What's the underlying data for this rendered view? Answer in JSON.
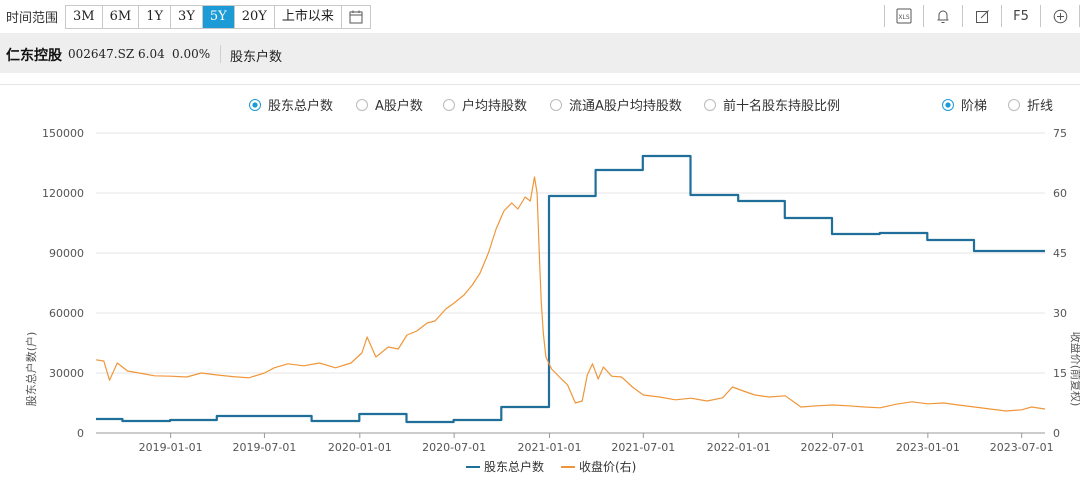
{
  "toolbar": {
    "range_label": "时间范围",
    "ranges": [
      "3M",
      "6M",
      "1Y",
      "3Y",
      "5Y",
      "20Y",
      "上市以来"
    ],
    "active_range": "5Y",
    "tools": [
      "XLS",
      "F5"
    ]
  },
  "stock": {
    "name": "仁东控股",
    "code": "002647.SZ",
    "price": "6.04",
    "change": "0.00%",
    "panel_title": "股东户数"
  },
  "options": {
    "metrics": [
      "股东总户数",
      "A股户数",
      "户均持股数",
      "流通A股户均持股数",
      "前十名股东持股比例"
    ],
    "selected_metric": "股东总户数",
    "styles": [
      "阶梯",
      "折线"
    ],
    "selected_style": "阶梯"
  },
  "colors": {
    "accent": "#1d9bd6",
    "holders": "#1f6f9a",
    "price": "#f0963a",
    "grid": "#e5e5e5"
  },
  "chart_data": {
    "type": "line",
    "ylabel": "股东总户数(户)",
    "y2label": "收盘价(前复权)",
    "ylim": [
      0,
      150000
    ],
    "y2lim": [
      0,
      75
    ],
    "yticks": [
      0,
      30000,
      60000,
      90000,
      120000,
      150000
    ],
    "y2ticks": [
      0,
      15,
      30,
      45,
      60,
      75
    ],
    "xlim": [
      "2018-08-10",
      "2023-08-15"
    ],
    "xticks": [
      "2019-01-01",
      "2019-07-01",
      "2020-01-01",
      "2020-07-01",
      "2021-01-01",
      "2021-07-01",
      "2022-01-01",
      "2022-07-01",
      "2023-01-01",
      "2023-07-01"
    ],
    "legend": [
      "股东总户数",
      "收盘价(右)"
    ],
    "grid": true,
    "series": [
      {
        "name": "股东总户数",
        "axis": "left",
        "style": "step",
        "points": [
          [
            "2018-08-10",
            7000
          ],
          [
            "2018-09-30",
            6000
          ],
          [
            "2018-12-31",
            6500
          ],
          [
            "2019-03-31",
            8500
          ],
          [
            "2019-06-30",
            8500
          ],
          [
            "2019-09-30",
            6000
          ],
          [
            "2019-12-31",
            9500
          ],
          [
            "2020-03-31",
            5500
          ],
          [
            "2020-06-30",
            6500
          ],
          [
            "2020-09-30",
            13000
          ],
          [
            "2020-12-31",
            118500
          ],
          [
            "2021-03-31",
            131500
          ],
          [
            "2021-06-30",
            138500
          ],
          [
            "2021-09-30",
            119000
          ],
          [
            "2021-12-31",
            116000
          ],
          [
            "2022-03-31",
            107500
          ],
          [
            "2022-06-30",
            99500
          ],
          [
            "2022-09-30",
            100000
          ],
          [
            "2022-12-31",
            96500
          ],
          [
            "2023-03-31",
            91000
          ],
          [
            "2023-08-15",
            91000
          ]
        ]
      },
      {
        "name": "收盘价(右)",
        "axis": "right",
        "style": "line",
        "points": [
          [
            "2018-08-10",
            18.3
          ],
          [
            "2018-08-25",
            18.0
          ],
          [
            "2018-09-05",
            13.2
          ],
          [
            "2018-09-20",
            17.5
          ],
          [
            "2018-10-10",
            15.5
          ],
          [
            "2018-11-01",
            15.0
          ],
          [
            "2018-12-01",
            14.3
          ],
          [
            "2019-01-01",
            14.2
          ],
          [
            "2019-02-01",
            14.0
          ],
          [
            "2019-03-01",
            15.0
          ],
          [
            "2019-04-01",
            14.5
          ],
          [
            "2019-05-01",
            14.1
          ],
          [
            "2019-06-01",
            13.8
          ],
          [
            "2019-07-01",
            15.0
          ],
          [
            "2019-07-20",
            16.3
          ],
          [
            "2019-08-15",
            17.3
          ],
          [
            "2019-09-15",
            16.8
          ],
          [
            "2019-10-15",
            17.5
          ],
          [
            "2019-11-15",
            16.3
          ],
          [
            "2019-12-15",
            17.5
          ],
          [
            "2020-01-05",
            20.0
          ],
          [
            "2020-01-15",
            24.0
          ],
          [
            "2020-02-01",
            19.0
          ],
          [
            "2020-02-25",
            21.5
          ],
          [
            "2020-03-15",
            21.0
          ],
          [
            "2020-04-01",
            24.5
          ],
          [
            "2020-04-20",
            25.5
          ],
          [
            "2020-05-10",
            27.5
          ],
          [
            "2020-05-25",
            28.0
          ],
          [
            "2020-06-15",
            31.0
          ],
          [
            "2020-07-01",
            32.5
          ],
          [
            "2020-07-20",
            34.5
          ],
          [
            "2020-08-05",
            37.0
          ],
          [
            "2020-08-20",
            40.0
          ],
          [
            "2020-09-05",
            45.0
          ],
          [
            "2020-09-20",
            51.0
          ],
          [
            "2020-10-05",
            55.5
          ],
          [
            "2020-10-20",
            57.5
          ],
          [
            "2020-11-01",
            56.0
          ],
          [
            "2020-11-15",
            59.0
          ],
          [
            "2020-11-25",
            58.0
          ],
          [
            "2020-12-03",
            64.0
          ],
          [
            "2020-12-08",
            60.0
          ],
          [
            "2020-12-12",
            46.0
          ],
          [
            "2020-12-16",
            33.0
          ],
          [
            "2020-12-20",
            25.0
          ],
          [
            "2020-12-25",
            19.0
          ],
          [
            "2021-01-05",
            16.0
          ],
          [
            "2021-01-20",
            14.0
          ],
          [
            "2021-02-05",
            12.0
          ],
          [
            "2021-02-20",
            7.5
          ],
          [
            "2021-03-05",
            8.0
          ],
          [
            "2021-03-15",
            14.5
          ],
          [
            "2021-03-25",
            17.3
          ],
          [
            "2021-04-05",
            13.5
          ],
          [
            "2021-04-15",
            16.5
          ],
          [
            "2021-05-01",
            14.2
          ],
          [
            "2021-05-20",
            14.0
          ],
          [
            "2021-06-10",
            11.5
          ],
          [
            "2021-07-01",
            9.5
          ],
          [
            "2021-08-01",
            9.0
          ],
          [
            "2021-09-01",
            8.3
          ],
          [
            "2021-10-01",
            8.7
          ],
          [
            "2021-11-01",
            8.0
          ],
          [
            "2021-12-01",
            8.8
          ],
          [
            "2021-12-20",
            11.5
          ],
          [
            "2022-01-10",
            10.5
          ],
          [
            "2022-02-01",
            9.5
          ],
          [
            "2022-03-01",
            9.0
          ],
          [
            "2022-04-01",
            9.3
          ],
          [
            "2022-05-01",
            6.5
          ],
          [
            "2022-06-01",
            6.8
          ],
          [
            "2022-07-01",
            7.0
          ],
          [
            "2022-08-01",
            6.8
          ],
          [
            "2022-09-01",
            6.5
          ],
          [
            "2022-10-01",
            6.3
          ],
          [
            "2022-11-01",
            7.2
          ],
          [
            "2022-12-01",
            7.8
          ],
          [
            "2023-01-01",
            7.3
          ],
          [
            "2023-02-01",
            7.5
          ],
          [
            "2023-03-01",
            7.0
          ],
          [
            "2023-04-01",
            6.5
          ],
          [
            "2023-05-01",
            6.0
          ],
          [
            "2023-06-01",
            5.5
          ],
          [
            "2023-07-01",
            5.8
          ],
          [
            "2023-07-20",
            6.5
          ],
          [
            "2023-08-15",
            6.0
          ]
        ]
      }
    ]
  }
}
